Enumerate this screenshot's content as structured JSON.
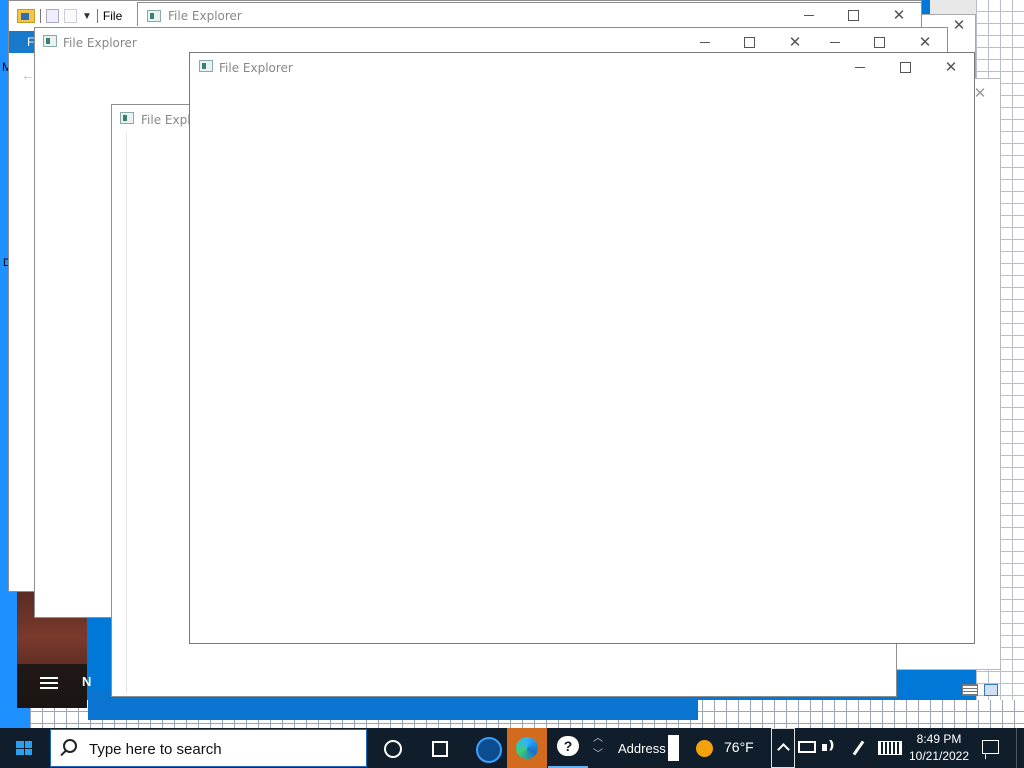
{
  "windows": [
    {
      "id": "explorer-back",
      "title": "File Explorer",
      "quick_access": {
        "file_tab": "File",
        "ribbon_tab": "F"
      }
    },
    {
      "id": "explorer-2",
      "title": "File Explorer"
    },
    {
      "id": "explorer-3",
      "title": "File Explorer"
    },
    {
      "id": "explorer-4",
      "title": "File Explorer"
    },
    {
      "id": "explorer-front",
      "title": "File Explorer"
    }
  ],
  "window_controls": {
    "minimize": "—",
    "maximize": "□",
    "close": "✕"
  },
  "side_letters": {
    "m": "M",
    "d": "D",
    "n": "N",
    "ellipsis": "..."
  },
  "taskbar": {
    "search_placeholder": "Type here to search",
    "address_label": "Address",
    "temperature": "76°F",
    "time": "8:49 PM",
    "date": "10/21/2022",
    "scroll_arrows": "︿\n﹀"
  },
  "icons": {
    "start": "windows-logo-icon",
    "search": "search-icon",
    "cortana": "cortana-icon",
    "taskview": "task-view-icon",
    "edge": "edge-icon",
    "help": "help-icon",
    "weather": "weather-sun-icon",
    "network": "network-icon",
    "volume": "volume-icon",
    "pen": "pen-icon",
    "keyboard": "keyboard-icon",
    "notifications": "notifications-icon"
  },
  "colors": {
    "desktop": "#0078d7",
    "taskbar": "#101e2b",
    "accent": "#1a6dbd"
  }
}
